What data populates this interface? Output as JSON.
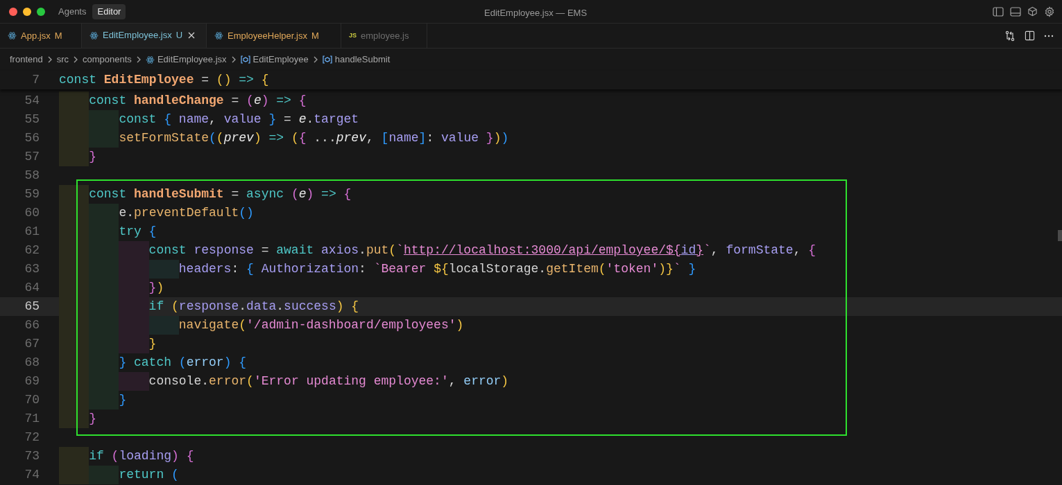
{
  "window": {
    "title": "EditEmployee.jsx — EMS"
  },
  "mode_tabs": [
    {
      "label": "Agents",
      "selected": false
    },
    {
      "label": "Editor",
      "selected": true
    }
  ],
  "tabs": [
    {
      "label": "App.jsx",
      "badge": "M",
      "color": "#e2a95a",
      "kind": "react",
      "selected": false
    },
    {
      "label": "EditEmployee.jsx",
      "badge": "U",
      "color": "#7ec3d9",
      "kind": "react",
      "selected": true
    },
    {
      "label": "EmployeeHelper.jsx",
      "badge": "M",
      "color": "#e2a95a",
      "kind": "react",
      "selected": false
    },
    {
      "label": "employee.js",
      "color": "#6e6e6e",
      "kind": "js",
      "icon_text": "JS",
      "selected": false
    }
  ],
  "breadcrumb": [
    {
      "label": "frontend",
      "kind": "folder"
    },
    {
      "label": "src",
      "kind": "folder"
    },
    {
      "label": "components",
      "kind": "folder"
    },
    {
      "label": "EditEmployee.jsx",
      "kind": "react"
    },
    {
      "label": "EditEmployee",
      "kind": "symbol"
    },
    {
      "label": "handleSubmit",
      "kind": "symbol"
    }
  ],
  "sticky_lines": [
    {
      "number": "7",
      "tokens": [
        {
          "text": "const",
          "kind": "keyword"
        },
        {
          "text": " EditEmployee",
          "kind": "declaration"
        },
        {
          "text": " =",
          "kind": "plain"
        },
        {
          "text": " ()",
          "kind": "bracket1"
        },
        {
          "text": " =>",
          "kind": "keyword"
        },
        {
          "text": " {",
          "kind": "bracket1"
        }
      ]
    }
  ],
  "lines": [
    {
      "number": "54",
      "current": false,
      "tokens": [
        {
          "text": "    const",
          "kind": "keyword"
        },
        {
          "text": " handleChange",
          "kind": "declaration"
        },
        {
          "text": " =",
          "kind": "plain"
        },
        {
          "text": " (",
          "kind": "bracket2"
        },
        {
          "text": "e",
          "kind": "parameter"
        },
        {
          "text": ")",
          "kind": "bracket2"
        },
        {
          "text": " =>",
          "kind": "keyword"
        },
        {
          "text": " {",
          "kind": "bracket2"
        }
      ]
    },
    {
      "number": "55",
      "current": false,
      "tokens": [
        {
          "text": "        const",
          "kind": "keyword"
        },
        {
          "text": " {",
          "kind": "bracket3"
        },
        {
          "text": " name",
          "kind": "variable"
        },
        {
          "text": ",",
          "kind": "plain"
        },
        {
          "text": " value",
          "kind": "variable"
        },
        {
          "text": " }",
          "kind": "bracket3"
        },
        {
          "text": " =",
          "kind": "plain"
        },
        {
          "text": " e",
          "kind": "parameter"
        },
        {
          "text": ".",
          "kind": "plain"
        },
        {
          "text": "target",
          "kind": "variable"
        }
      ]
    },
    {
      "number": "56",
      "current": false,
      "tokens": [
        {
          "text": "        setFormState",
          "kind": "call"
        },
        {
          "text": "(",
          "kind": "bracket3"
        },
        {
          "text": "(",
          "kind": "bracket1"
        },
        {
          "text": "prev",
          "kind": "parameter"
        },
        {
          "text": ")",
          "kind": "bracket1"
        },
        {
          "text": " =>",
          "kind": "keyword"
        },
        {
          "text": " (",
          "kind": "bracket1"
        },
        {
          "text": "{",
          "kind": "bracket2"
        },
        {
          "text": " ...",
          "kind": "plain"
        },
        {
          "text": "prev",
          "kind": "parameter"
        },
        {
          "text": ",",
          "kind": "plain"
        },
        {
          "text": " [",
          "kind": "bracket3"
        },
        {
          "text": "name",
          "kind": "variable"
        },
        {
          "text": "]",
          "kind": "bracket3"
        },
        {
          "text": ":",
          "kind": "plain"
        },
        {
          "text": " value",
          "kind": "variable"
        },
        {
          "text": " }",
          "kind": "bracket2"
        },
        {
          "text": ")",
          "kind": "bracket1"
        },
        {
          "text": ")",
          "kind": "bracket3"
        }
      ]
    },
    {
      "number": "57",
      "current": false,
      "tokens": [
        {
          "text": "    }",
          "kind": "bracket2"
        }
      ]
    },
    {
      "number": "58",
      "current": false
    },
    {
      "number": "59",
      "current": false,
      "tokens": [
        {
          "text": "    const",
          "kind": "keyword"
        },
        {
          "text": " handleSubmit",
          "kind": "declaration"
        },
        {
          "text": " =",
          "kind": "plain"
        },
        {
          "text": " async",
          "kind": "keyword"
        },
        {
          "text": " (",
          "kind": "bracket2"
        },
        {
          "text": "e",
          "kind": "parameter"
        },
        {
          "text": ")",
          "kind": "bracket2"
        },
        {
          "text": " =>",
          "kind": "keyword"
        },
        {
          "text": " {",
          "kind": "bracket2"
        }
      ]
    },
    {
      "number": "60",
      "current": false,
      "tokens": [
        {
          "text": "        e",
          "kind": "plain"
        },
        {
          "text": ".",
          "kind": "plain"
        },
        {
          "text": "preventDefault",
          "kind": "call"
        },
        {
          "text": "()",
          "kind": "bracket3"
        }
      ]
    },
    {
      "number": "61",
      "current": false,
      "tokens": [
        {
          "text": "        try",
          "kind": "keyword"
        },
        {
          "text": " {",
          "kind": "bracket3"
        }
      ]
    },
    {
      "number": "62",
      "current": false,
      "tokens": [
        {
          "text": "            const",
          "kind": "keyword"
        },
        {
          "text": " response",
          "kind": "variable"
        },
        {
          "text": " =",
          "kind": "plain"
        },
        {
          "text": " await",
          "kind": "keyword"
        },
        {
          "text": " axios",
          "kind": "variable"
        },
        {
          "text": ".",
          "kind": "plain"
        },
        {
          "text": "put",
          "kind": "call"
        },
        {
          "text": "(",
          "kind": "bracket1"
        },
        {
          "text": "`",
          "kind": "string"
        },
        {
          "text": "http://localhost:3000/api/employee/${",
          "kind": "link"
        },
        {
          "text": "id",
          "kind": "link_variable"
        },
        {
          "text": "}",
          "kind": "link"
        },
        {
          "text": "`",
          "kind": "string"
        },
        {
          "text": ",",
          "kind": "plain"
        },
        {
          "text": " formState",
          "kind": "variable"
        },
        {
          "text": ",",
          "kind": "plain"
        },
        {
          "text": " {",
          "kind": "bracket2"
        }
      ]
    },
    {
      "number": "63",
      "current": false,
      "tokens": [
        {
          "text": "                headers",
          "kind": "variable"
        },
        {
          "text": ":",
          "kind": "plain"
        },
        {
          "text": " {",
          "kind": "bracket3"
        },
        {
          "text": " Authorization",
          "kind": "variable"
        },
        {
          "text": ":",
          "kind": "plain"
        },
        {
          "text": " `Bearer ",
          "kind": "string"
        },
        {
          "text": "${",
          "kind": "bracket1"
        },
        {
          "text": "localStorage",
          "kind": "plain"
        },
        {
          "text": ".",
          "kind": "plain"
        },
        {
          "text": "getItem",
          "kind": "call"
        },
        {
          "text": "(",
          "kind": "bracket1"
        },
        {
          "text": "'token'",
          "kind": "string"
        },
        {
          "text": ")",
          "kind": "bracket1"
        },
        {
          "text": "}",
          "kind": "bracket1"
        },
        {
          "text": "`",
          "kind": "string"
        },
        {
          "text": " }",
          "kind": "bracket3"
        }
      ]
    },
    {
      "number": "64",
      "current": false,
      "tokens": [
        {
          "text": "            }",
          "kind": "bracket2"
        },
        {
          "text": ")",
          "kind": "bracket1"
        }
      ]
    },
    {
      "number": "65",
      "current": true,
      "tokens": [
        {
          "text": "            if",
          "kind": "keyword"
        },
        {
          "text": " (",
          "kind": "bracket1"
        },
        {
          "text": "response",
          "kind": "variable"
        },
        {
          "text": ".",
          "kind": "plain"
        },
        {
          "text": "data",
          "kind": "variable"
        },
        {
          "text": ".",
          "kind": "plain"
        },
        {
          "text": "success",
          "kind": "variable"
        },
        {
          "text": ")",
          "kind": "bracket1"
        },
        {
          "text": " {",
          "kind": "bracket1"
        }
      ]
    },
    {
      "number": "66",
      "current": false,
      "tokens": [
        {
          "text": "                navigate",
          "kind": "call"
        },
        {
          "text": "(",
          "kind": "bracket1"
        },
        {
          "text": "'/admin-dashboard/employees'",
          "kind": "string"
        },
        {
          "text": ")",
          "kind": "bracket1"
        }
      ]
    },
    {
      "number": "67",
      "current": false,
      "tokens": [
        {
          "text": "            }",
          "kind": "bracket1"
        }
      ]
    },
    {
      "number": "68",
      "current": false,
      "tokens": [
        {
          "text": "        }",
          "kind": "bracket3"
        },
        {
          "text": " catch",
          "kind": "keyword"
        },
        {
          "text": " (",
          "kind": "bracket3"
        },
        {
          "text": "error",
          "kind": "local"
        },
        {
          "text": ")",
          "kind": "bracket3"
        },
        {
          "text": " {",
          "kind": "bracket3"
        }
      ]
    },
    {
      "number": "69",
      "current": false,
      "tokens": [
        {
          "text": "            console",
          "kind": "plain"
        },
        {
          "text": ".",
          "kind": "plain"
        },
        {
          "text": "error",
          "kind": "call"
        },
        {
          "text": "(",
          "kind": "bracket1"
        },
        {
          "text": "'Error updating employee:'",
          "kind": "string"
        },
        {
          "text": ",",
          "kind": "plain"
        },
        {
          "text": " error",
          "kind": "local"
        },
        {
          "text": ")",
          "kind": "bracket1"
        }
      ]
    },
    {
      "number": "70",
      "current": false,
      "tokens": [
        {
          "text": "        }",
          "kind": "bracket3"
        }
      ]
    },
    {
      "number": "71",
      "current": false,
      "tokens": [
        {
          "text": "    }",
          "kind": "bracket2"
        }
      ]
    },
    {
      "number": "72",
      "current": false
    },
    {
      "number": "73",
      "current": false,
      "tokens": [
        {
          "text": "    if",
          "kind": "keyword"
        },
        {
          "text": " (",
          "kind": "bracket2"
        },
        {
          "text": "loading",
          "kind": "variable"
        },
        {
          "text": ")",
          "kind": "bracket2"
        },
        {
          "text": " {",
          "kind": "bracket2"
        }
      ]
    },
    {
      "number": "74",
      "current": false,
      "tokens": [
        {
          "text": "        return",
          "kind": "keyword"
        },
        {
          "text": " (",
          "kind": "bracket3"
        }
      ]
    }
  ]
}
